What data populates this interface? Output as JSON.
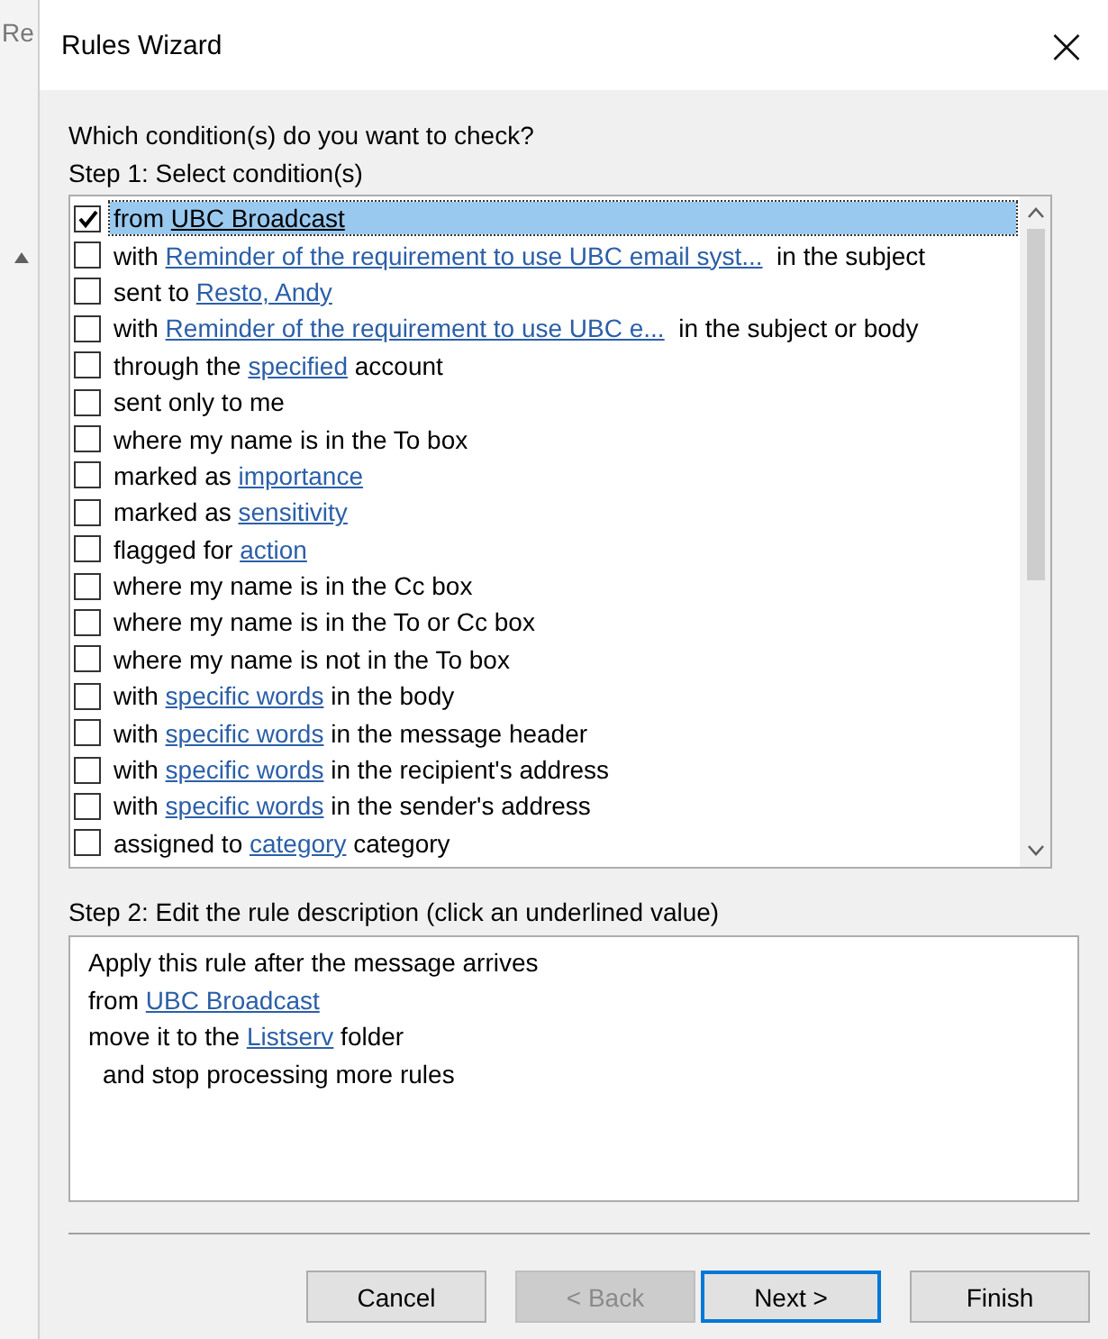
{
  "background_window": {
    "title": "Re"
  },
  "window": {
    "title": "Rules Wizard",
    "close": "×"
  },
  "question": "Which condition(s) do you want to check?",
  "step1": {
    "label": "Step 1: Select condition(s)",
    "conditions": [
      {
        "checked": true,
        "selected": true,
        "parts": [
          {
            "kind": "text",
            "text": "from "
          },
          {
            "kind": "link",
            "text": "UBC Broadcast"
          }
        ]
      },
      {
        "checked": false,
        "selected": false,
        "parts": [
          {
            "kind": "text",
            "text": "with "
          },
          {
            "kind": "link",
            "text": "Reminder of the requirement to use UBC email syst..."
          },
          {
            "kind": "text",
            "text": "  in the subject"
          }
        ]
      },
      {
        "checked": false,
        "selected": false,
        "parts": [
          {
            "kind": "text",
            "text": "sent to "
          },
          {
            "kind": "link",
            "text": "Resto, Andy"
          }
        ]
      },
      {
        "checked": false,
        "selected": false,
        "parts": [
          {
            "kind": "text",
            "text": "with "
          },
          {
            "kind": "link",
            "text": "Reminder of the requirement to use UBC e..."
          },
          {
            "kind": "text",
            "text": "  in the subject or body"
          }
        ]
      },
      {
        "checked": false,
        "selected": false,
        "parts": [
          {
            "kind": "text",
            "text": "through the "
          },
          {
            "kind": "link",
            "text": "specified"
          },
          {
            "kind": "text",
            "text": " account"
          }
        ]
      },
      {
        "checked": false,
        "selected": false,
        "parts": [
          {
            "kind": "text",
            "text": "sent only to me"
          }
        ]
      },
      {
        "checked": false,
        "selected": false,
        "parts": [
          {
            "kind": "text",
            "text": "where my name is in the To box"
          }
        ]
      },
      {
        "checked": false,
        "selected": false,
        "parts": [
          {
            "kind": "text",
            "text": "marked as "
          },
          {
            "kind": "link",
            "text": "importance"
          }
        ]
      },
      {
        "checked": false,
        "selected": false,
        "parts": [
          {
            "kind": "text",
            "text": "marked as "
          },
          {
            "kind": "link",
            "text": "sensitivity"
          }
        ]
      },
      {
        "checked": false,
        "selected": false,
        "parts": [
          {
            "kind": "text",
            "text": "flagged for "
          },
          {
            "kind": "link",
            "text": "action"
          }
        ]
      },
      {
        "checked": false,
        "selected": false,
        "parts": [
          {
            "kind": "text",
            "text": "where my name is in the Cc box"
          }
        ]
      },
      {
        "checked": false,
        "selected": false,
        "parts": [
          {
            "kind": "text",
            "text": "where my name is in the To or Cc box"
          }
        ]
      },
      {
        "checked": false,
        "selected": false,
        "parts": [
          {
            "kind": "text",
            "text": "where my name is not in the To box"
          }
        ]
      },
      {
        "checked": false,
        "selected": false,
        "parts": [
          {
            "kind": "text",
            "text": "with "
          },
          {
            "kind": "link",
            "text": "specific words"
          },
          {
            "kind": "text",
            "text": " in the body"
          }
        ]
      },
      {
        "checked": false,
        "selected": false,
        "parts": [
          {
            "kind": "text",
            "text": "with "
          },
          {
            "kind": "link",
            "text": "specific words"
          },
          {
            "kind": "text",
            "text": " in the message header"
          }
        ]
      },
      {
        "checked": false,
        "selected": false,
        "parts": [
          {
            "kind": "text",
            "text": "with "
          },
          {
            "kind": "link",
            "text": "specific words"
          },
          {
            "kind": "text",
            "text": " in the recipient's address"
          }
        ]
      },
      {
        "checked": false,
        "selected": false,
        "parts": [
          {
            "kind": "text",
            "text": "with "
          },
          {
            "kind": "link",
            "text": "specific words"
          },
          {
            "kind": "text",
            "text": " in the sender's address"
          }
        ]
      },
      {
        "checked": false,
        "selected": false,
        "parts": [
          {
            "kind": "text",
            "text": "assigned to "
          },
          {
            "kind": "link",
            "text": "category"
          },
          {
            "kind": "text",
            "text": " category"
          }
        ]
      }
    ]
  },
  "step2": {
    "label": "Step 2: Edit the rule description (click an underlined value)",
    "lines": [
      {
        "indented": false,
        "parts": [
          {
            "kind": "text",
            "text": "Apply this rule after the message arrives"
          }
        ]
      },
      {
        "indented": false,
        "parts": [
          {
            "kind": "text",
            "text": "from "
          },
          {
            "kind": "link",
            "text": "UBC Broadcast"
          }
        ]
      },
      {
        "indented": false,
        "parts": [
          {
            "kind": "text",
            "text": "move it to the "
          },
          {
            "kind": "link",
            "text": "Listserv"
          },
          {
            "kind": "text",
            "text": " folder"
          }
        ]
      },
      {
        "indented": true,
        "parts": [
          {
            "kind": "text",
            "text": "and stop processing more rules"
          }
        ]
      }
    ]
  },
  "buttons": [
    {
      "label": "Cancel",
      "disabled": false,
      "default": false
    },
    {
      "label": "< Back",
      "disabled": true,
      "default": false
    },
    {
      "label": "Next >",
      "disabled": false,
      "default": true
    },
    {
      "label": "Finish",
      "disabled": false,
      "default": false
    }
  ]
}
